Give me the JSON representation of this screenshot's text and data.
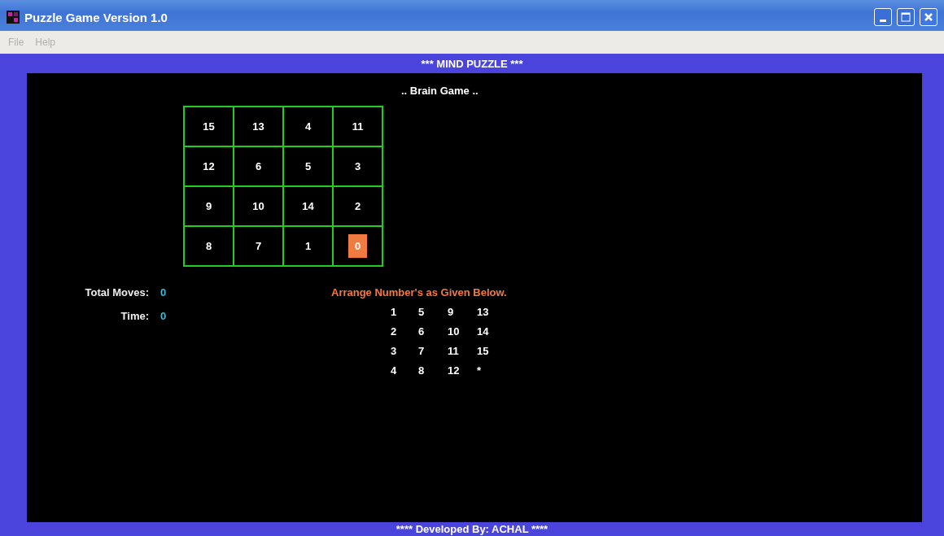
{
  "window": {
    "title": "Puzzle Game Version 1.0"
  },
  "menu": [
    "File",
    "Help"
  ],
  "header": "*** MIND PUZZLE ***",
  "subtitle": ".. Brain Game ..",
  "board": [
    [
      {
        "label": "15",
        "selected": false
      },
      {
        "label": "13",
        "selected": false
      },
      {
        "label": "4",
        "selected": false
      },
      {
        "label": "11",
        "selected": false
      }
    ],
    [
      {
        "label": "12",
        "selected": false
      },
      {
        "label": "6",
        "selected": false
      },
      {
        "label": "5",
        "selected": false
      },
      {
        "label": "3",
        "selected": false
      }
    ],
    [
      {
        "label": "9",
        "selected": false
      },
      {
        "label": "10",
        "selected": false
      },
      {
        "label": "14",
        "selected": false
      },
      {
        "label": "2",
        "selected": false
      }
    ],
    [
      {
        "label": "8",
        "selected": false
      },
      {
        "label": "7",
        "selected": false
      },
      {
        "label": "1",
        "selected": false
      },
      {
        "label": "0",
        "selected": true
      }
    ]
  ],
  "stats": [
    {
      "label": "Total Moves:",
      "value": "0"
    },
    {
      "label": "Time:",
      "value": "0"
    }
  ],
  "goal": {
    "title": "Arrange Number's as Given Below.",
    "rows": [
      [
        "1",
        "5",
        "9",
        "13"
      ],
      [
        "2",
        "6",
        "10",
        "14"
      ],
      [
        "3",
        "7",
        "11",
        "15"
      ],
      [
        "4",
        "8",
        "12",
        "*"
      ]
    ]
  },
  "footer": "**** Developed By: ACHAL ****"
}
